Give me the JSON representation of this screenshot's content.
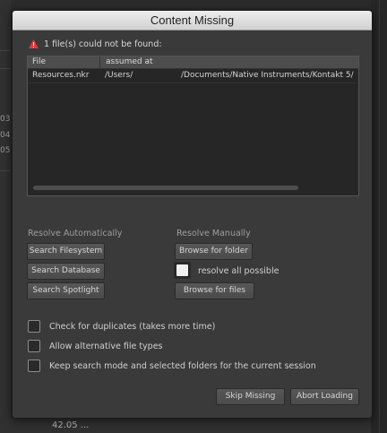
{
  "background": {
    "left_numbers": [
      "03",
      "04",
      "05"
    ],
    "bottom_value": "42.05 ..."
  },
  "dialog": {
    "title": "Content Missing",
    "warning_icon": "warning-triangle-icon",
    "warning_color": "#e03a3a",
    "warning_text": "1 file(s) could not be found:",
    "table": {
      "headers": [
        "File",
        "assumed at"
      ],
      "rows": [
        {
          "file": "Resources.nkr",
          "user_path": "/Users/",
          "rest_path": "/Documents/Native Instruments/Kontakt 5/"
        }
      ]
    },
    "resolve_auto": {
      "label": "Resolve Automatically",
      "buttons": [
        "Search Filesystem",
        "Search Database",
        "Search Spotlight"
      ]
    },
    "resolve_manual": {
      "label": "Resolve Manually",
      "browse_folder": "Browse for folder",
      "resolve_all_label": "resolve all possible",
      "resolve_all_checked": true,
      "browse_files": "Browse for files"
    },
    "options": [
      {
        "label": "Check for duplicates (takes more time)",
        "checked": false
      },
      {
        "label": "Allow alternative file types",
        "checked": false
      },
      {
        "label": "Keep search mode and selected folders for the current session",
        "checked": false
      }
    ],
    "footer": {
      "skip": "Skip Missing",
      "abort": "Abort Loading"
    }
  }
}
